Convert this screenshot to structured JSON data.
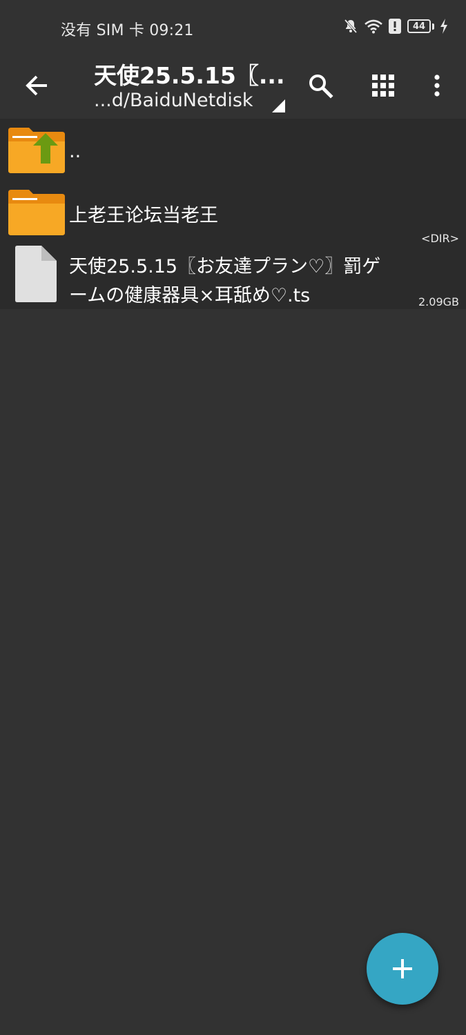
{
  "status_bar": {
    "carrier_time": "没有 SIM 卡 09:21",
    "battery_level": "44",
    "icons": [
      "bell-off-icon",
      "wifi-icon",
      "alert-icon",
      "battery-icon",
      "charging-icon"
    ]
  },
  "toolbar": {
    "title": "天使25.5.15〖...",
    "subtitle": "...d/BaiduNetdisk",
    "icons": [
      "back-arrow-icon",
      "search-icon",
      "grid-view-icon",
      "more-vert-icon"
    ]
  },
  "files": [
    {
      "name": "..",
      "type": "parent-folder",
      "meta": ""
    },
    {
      "name": "上老王论坛当老王",
      "type": "folder",
      "meta": "<DIR>"
    },
    {
      "name": "天使25.5.15〖お友達プラン♡〗罰ゲームの健康器具×耳舐め♡.ts",
      "type": "file",
      "meta": "2.09GB"
    }
  ],
  "colors": {
    "background": "#323232",
    "list_background": "#2b2b2b",
    "folder": "#f7a825",
    "folder_tab": "#e88a10",
    "up_arrow": "#6b9a12",
    "file_icon": "#e0e0e0",
    "fab": "#35a6c4"
  },
  "fab": {
    "icon": "plus-icon"
  }
}
